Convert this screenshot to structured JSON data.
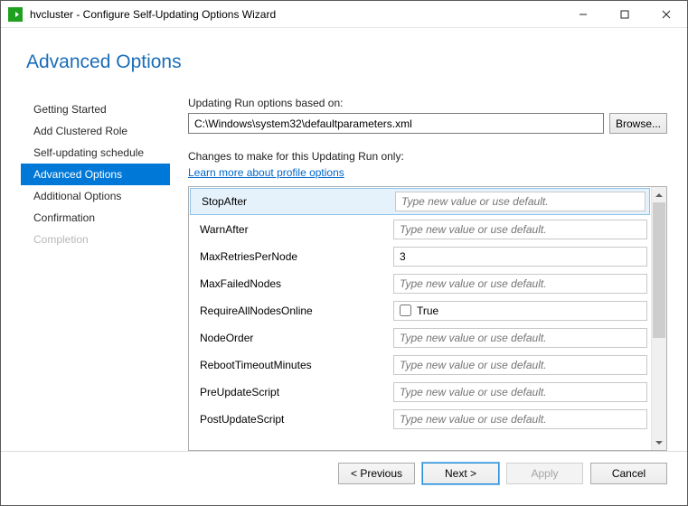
{
  "window": {
    "title": "hvcluster - Configure Self-Updating Options Wizard"
  },
  "heading": "Advanced Options",
  "sidebar": {
    "items": [
      {
        "label": "Getting Started",
        "state": "normal"
      },
      {
        "label": "Add Clustered Role",
        "state": "normal"
      },
      {
        "label": "Self-updating schedule",
        "state": "normal"
      },
      {
        "label": "Advanced Options",
        "state": "selected"
      },
      {
        "label": "Additional Options",
        "state": "normal"
      },
      {
        "label": "Confirmation",
        "state": "normal"
      },
      {
        "label": "Completion",
        "state": "disabled"
      }
    ]
  },
  "content": {
    "basedOnLabel": "Updating Run options based on:",
    "profilePath": "C:\\Windows\\system32\\defaultparameters.xml",
    "browseLabel": "Browse...",
    "changesLabel": "Changes to make for this Updating Run only:",
    "learnMore": "Learn more about profile options",
    "placeholder": "Type new value or use default.",
    "params": [
      {
        "name": "StopAfter",
        "type": "text",
        "value": "",
        "selected": true
      },
      {
        "name": "WarnAfter",
        "type": "text",
        "value": ""
      },
      {
        "name": "MaxRetriesPerNode",
        "type": "text",
        "value": "3"
      },
      {
        "name": "MaxFailedNodes",
        "type": "text",
        "value": ""
      },
      {
        "name": "RequireAllNodesOnline",
        "type": "bool",
        "boolLabel": "True",
        "checked": false
      },
      {
        "name": "NodeOrder",
        "type": "text",
        "value": ""
      },
      {
        "name": "RebootTimeoutMinutes",
        "type": "text",
        "value": ""
      },
      {
        "name": "PreUpdateScript",
        "type": "text",
        "value": ""
      },
      {
        "name": "PostUpdateScript",
        "type": "text",
        "value": ""
      }
    ]
  },
  "footer": {
    "previous": "< Previous",
    "next": "Next >",
    "apply": "Apply",
    "cancel": "Cancel"
  }
}
